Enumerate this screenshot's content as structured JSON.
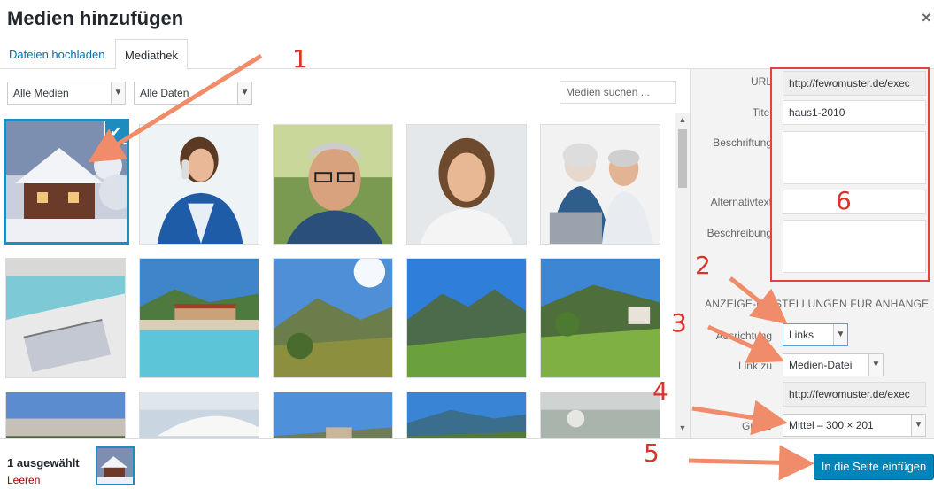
{
  "dialog": {
    "title": "Medien hinzufügen",
    "close_glyph": "×"
  },
  "tabs": [
    {
      "label": "Dateien hochladen",
      "active": false
    },
    {
      "label": "Mediathek",
      "active": true
    }
  ],
  "filters": {
    "media_type": "Alle Medien",
    "date": "Alle Daten",
    "search_placeholder": "Medien suchen ..."
  },
  "grid": {
    "items": [
      {
        "name": "winter-house",
        "selected": true
      },
      {
        "name": "woman-phone"
      },
      {
        "name": "man-glasses"
      },
      {
        "name": "woman-smiling"
      },
      {
        "name": "senior-couple-laptop"
      },
      {
        "name": "pool-lounger"
      },
      {
        "name": "hotel-pool"
      },
      {
        "name": "hills-trees"
      },
      {
        "name": "mountain-valley"
      },
      {
        "name": "meadow-house"
      },
      {
        "name": "forest-road"
      },
      {
        "name": "parasol"
      },
      {
        "name": "village-mountain"
      },
      {
        "name": "blue-mountains"
      },
      {
        "name": "blurry-table"
      }
    ]
  },
  "details": {
    "url_label": "URL",
    "url_value": "http://fewomuster.de/exec",
    "title_label": "Titel",
    "title_value": "haus1-2010",
    "caption_label": "Beschriftung",
    "caption_value": "",
    "alt_label": "Alternativtext",
    "alt_value": "",
    "description_label": "Beschreibung",
    "description_value": ""
  },
  "display_settings": {
    "heading": "Anzeige-Einstellungen für Anhänge",
    "alignment_label": "Ausrichtung",
    "alignment_value": "Links",
    "link_label": "Link zu",
    "link_value": "Medien-Datei",
    "link_url": "http://fewomuster.de/exec",
    "size_label": "Größe",
    "size_value": "Mittel – 300 × 201"
  },
  "footer": {
    "selected_count": "1 ausgewählt",
    "clear_label": "Leeren",
    "insert_button": "In die Seite einfügen"
  },
  "annotations": [
    "1",
    "2",
    "3",
    "4",
    "5",
    "6"
  ],
  "colors": {
    "accent": "#0085ba",
    "selected_border": "#1e8cbe",
    "annotation_red": "#e8413d",
    "arrow": "#f08c6a"
  }
}
